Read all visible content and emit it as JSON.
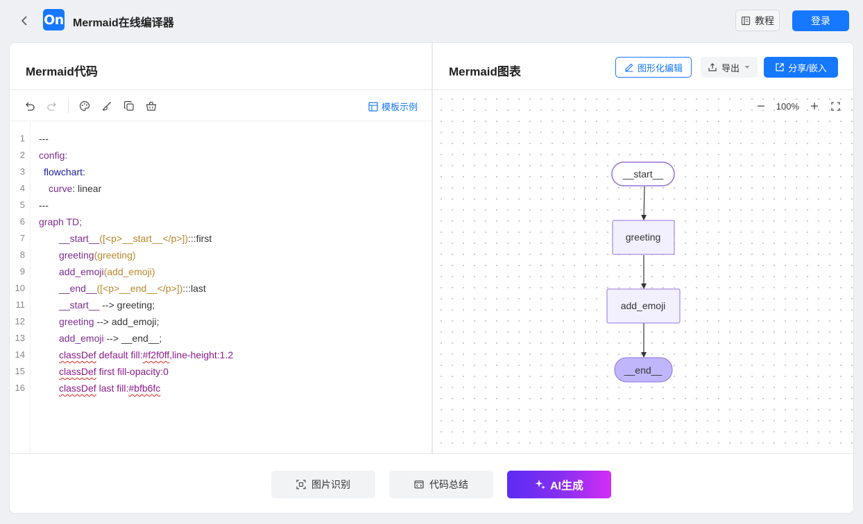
{
  "header": {
    "app_title": "Mermaid在线编译器",
    "logo_text": "On",
    "tutorial_label": "教程",
    "login_label": "登录"
  },
  "left_pane": {
    "title": "Mermaid代码",
    "template_label": "模板示例",
    "line_numbers": [
      "1",
      "2",
      "3",
      "4",
      "5",
      "6",
      "7",
      "8",
      "9",
      "10",
      "11",
      "12",
      "13",
      "14",
      "15",
      "16"
    ],
    "code": {
      "l1": "---",
      "l2": "config:",
      "l3": "flowchart:",
      "l4a": "curve",
      "l4b": ": linear",
      "l5": "---",
      "l6": "graph TD;",
      "l7a": "__start__",
      "l7b": "([<p>__start__</p>])",
      "l7c": ":::first",
      "l8a": "greeting",
      "l8b": "(greeting)",
      "l9a": "add_emoji",
      "l9b": "(add_emoji)",
      "l10a": "__end__",
      "l10b": "([<p>__end__</p>])",
      "l10c": ":::last",
      "l11a": "__start__",
      "l11b": " --> greeting;",
      "l12a": "greeting",
      "l12b": " --> add_emoji;",
      "l13a": "add_emoji",
      "l13b": " --> __end__;",
      "l14a": "classDef",
      "l14b": " default fill:",
      "l14c": "#f2f0ff",
      "l14d": ",line-height:1.2",
      "l15a": "classDef",
      "l15b": " first fill-opacity:0",
      "l16a": "classDef",
      "l16b": " last fill:",
      "l16c": "#bfb6fc"
    }
  },
  "right_pane": {
    "title": "Mermaid图表",
    "graphic_edit_label": "图形化编辑",
    "export_label": "导出",
    "share_label": "分享/嵌入",
    "zoom_level": "100%",
    "nodes": {
      "start": "__start__",
      "greeting": "greeting",
      "add_emoji": "add_emoji",
      "end": "__end__"
    },
    "colors": {
      "default_fill": "#f2f0ff",
      "last_fill": "#bfb6fc",
      "stroke": "#9370db"
    }
  },
  "bottom": {
    "image_recognition_label": "图片识别",
    "code_summary_label": "代码总结",
    "ai_generate_label": "AI生成"
  },
  "icons": [
    "back-icon",
    "book-icon",
    "undo-icon",
    "redo-icon",
    "palette-icon",
    "brush-icon",
    "copy-icon",
    "basket-icon",
    "template-icon",
    "edit-icon",
    "upload-icon",
    "caret-down-icon",
    "share-icon",
    "zoom-out-icon",
    "zoom-in-icon",
    "fullscreen-icon",
    "scan-icon",
    "code-icon",
    "sparkle-icon"
  ]
}
